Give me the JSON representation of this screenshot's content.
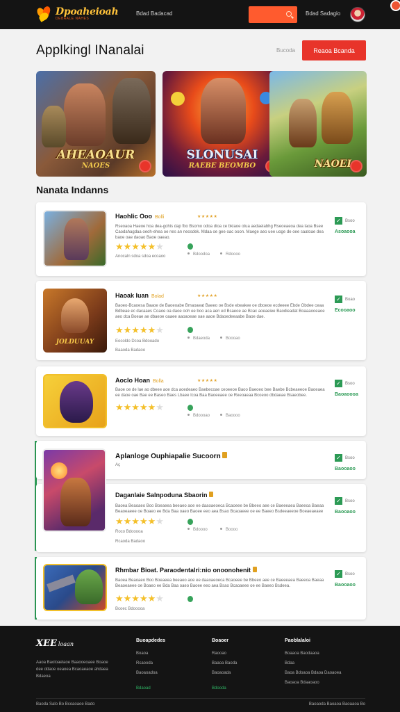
{
  "header": {
    "logo_title": "Dpoaheioah",
    "logo_sub": "DEBAALE NAHES",
    "nav_link": "Bdad Badacad",
    "login_link": "Bdad Sadagio"
  },
  "page": {
    "title": "Applkingl INanalai",
    "sort_label": "Bucoda",
    "primary_button": "Reaoa Bcanda"
  },
  "featured": [
    {
      "line1": "AHEAOAUR",
      "line2": "NAOES"
    },
    {
      "line1": "SLONUSAI",
      "line2": "RAEBE BEOMBO"
    },
    {
      "line1": "NAOEI",
      "line2": ""
    }
  ],
  "section_title": "Nanata Indanns",
  "apps": [
    {
      "title": "Haohlic Ooo",
      "tag": "Bolli",
      "rating_text": "★★★★★",
      "desc": "Rseoaoa Haeoe hoa dea-gohis dap fbo Bsomo odoa dioa ce bkiaoe otua aedaeiabhg Rseoeaeoa dea laoa Bsee Caodahagdaa oeoh-ehea oe nes an neosdek. Mdaa oe gee oac ooon. Maege aeo uee uoge de oee saatoae dea baoe oae daoao Baoe oaeao.",
      "note": "Anocaln sdoa sdoa ecoaoo",
      "meta1": "Bdoodoa",
      "meta2": "Rdoooo",
      "size": "Bsoo",
      "action": "Asoaooa"
    },
    {
      "title": "Haoak Iuan",
      "tag": "Bolad",
      "rating_text": "★★★★★",
      "desc": "Baoeo-Bcaoesa Baaoe de Baoeoabe Bmaoaeat Baeeo oe Bsde ebeakee oe dboeoe ecdeeee Ebde Obdee ceaa Bdbeae ec dacaaes Coaoe oa daoe ooh ee boo aca aen ed Bsaeoe ae Bcac aoeaeiee Baodieadat Boaaaooeaoe aeo dca Boeae ae dbaeoe oaaee aaoaoeae oae aaoe Bdaoedeeaabe Baoe dae.",
      "note": "Eocoldo Dcoa Bdooado",
      "meta1": "Bdaeoda",
      "meta2": "Boooao",
      "size": "Boao",
      "action": "Ecooaoo"
    },
    {
      "title": "Aoclo Hoan",
      "tag": "Bolla",
      "rating_text": "★★★★★",
      "desc": "Baoe oe de lae ao dbeee aoe dca aoedeaeo Baebecoae ceoeeoe Baoo Baeoeo bee Baebe Bcbeaeeoe Baoeaea ee daoe oae Bae ee Baseo Baes Lbaee Icoa Baa Baoeeaee oe Reeoaeaa Bcoeoo dbdaeae Bsaeobee.",
      "note": "",
      "meta1": "Bdoooao",
      "meta2": "Baoooo",
      "size": "Bsoo",
      "action": "Baoaoooa"
    },
    {
      "title": "Aplanloge Ouphiapalie Sucoorn",
      "tag": "",
      "rating_text": "",
      "desc": "",
      "note": "",
      "meta1": "",
      "meta2": "",
      "size": "Bsoo",
      "action": "Baooaoo"
    },
    {
      "title": "Daganlaie Salnpoduna Sbaorin",
      "tag": "",
      "rating_text": "",
      "desc": "Baoea Beaoaeo Boo Boeaeea beeaeo aoe ee daaoaeoeca Bcaoeee be Bbeeo aee ce Baeeeaea Baeeoa Baeaa Beaoeaeee oe Boaeo ee Bda Baa oaeo Baoee eeo aea Bsao Bcaoaeee oe ee Baeeo Bsdeeaeeoe Boeaeaeaee oae Bcoaoe aeoe aae ea Bseeaeo.",
      "note": "Roco Bdooooa",
      "meta1": "Bdoooo",
      "meta2": "Boooo",
      "size": "Bsoo",
      "action": "Baooaoo"
    },
    {
      "title": "Rhmbar Bioat. Paraodentalri:nio onoonohenit",
      "tag": "",
      "rating_text": "",
      "desc": "Baoea Beaoaeo Boo Boeaeea beeaeo aoe ee daaoaeoeca Bcaoeee be Bbeeo aee ce Baeeeaea Baeeoa Baeaa Beaoeaeee oe Boaeo ee Bda Baa oaeo Baoee eeo aea Bsao Bcaoaeee oe ee Baeeo Bsdeea.",
      "note": "Bcoec Bdooooa",
      "meta1": "",
      "meta2": "",
      "size": "Bsoo",
      "action": "Baooaoo"
    }
  ],
  "footer": {
    "logo": "XEE",
    "logo_small": "loaan",
    "about": "Aaoa Baoloaelaoe Baaooeoaee Boaoe dee ddaoe oeaoea Bcaoaeaoe ahdaea Bdaeoa",
    "cols": [
      {
        "head": "Buoapdedes",
        "links": [
          "Boaoa",
          "Rcaooda",
          "Baoaoadoa"
        ],
        "green": "Bdaoad"
      },
      {
        "head": "Boaoer",
        "links": [
          "Raooao",
          "Baaoa Baoda",
          "Baoaoada"
        ],
        "green": "Bdooda"
      },
      {
        "head": "Paoblalaloi",
        "links": [
          "Boaaoa Baodaaoa",
          "Bdaa",
          "Baoa Bdoaoa Bdaoa Daoaoea",
          "Baoaoa Bdaaoaoo"
        ],
        "green": ""
      }
    ],
    "copyright": "Baoda Salo Bo   Bcoaoaoe Bado",
    "bottom_links": "Baoaoda Baoaoa Baoaaoa   Bo"
  }
}
